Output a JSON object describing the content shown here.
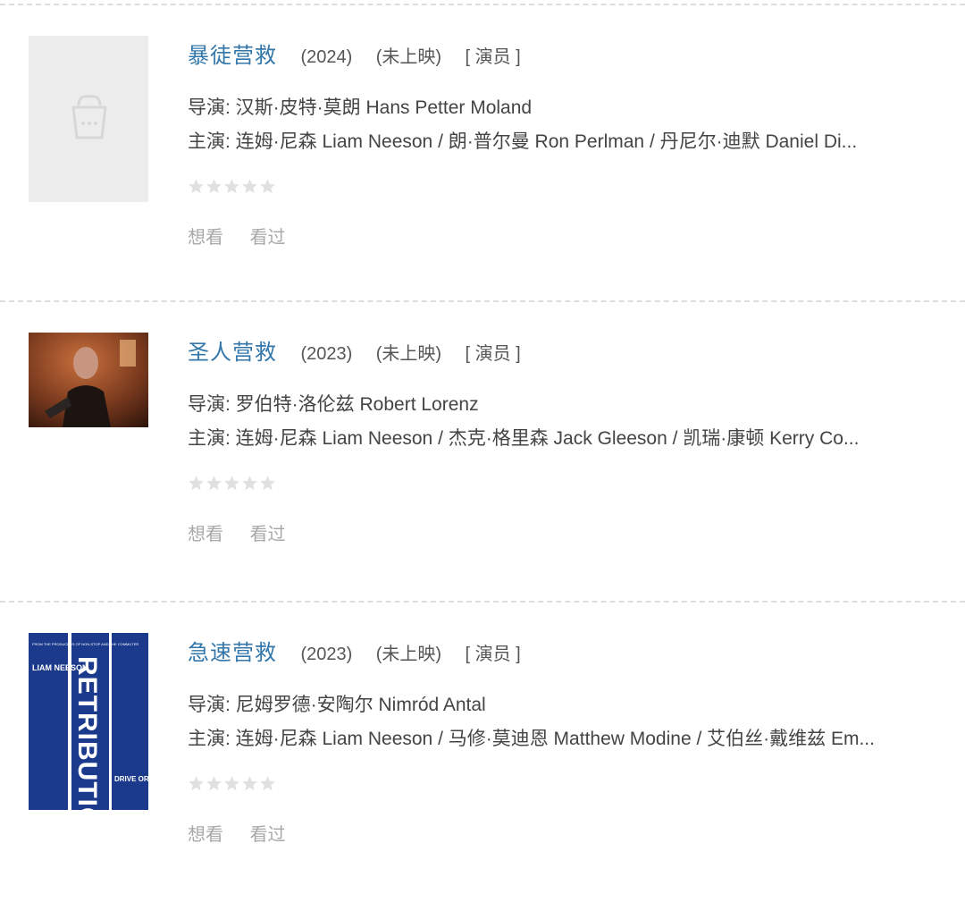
{
  "movies": [
    {
      "title": "暴徒营救",
      "year": "(2024)",
      "status": "(未上映)",
      "role": "[ 演员 ]",
      "director": "导演: 汉斯·皮特·莫朗 Hans Petter Moland",
      "cast": "主演: 连姆·尼森 Liam Neeson / 朗·普尔曼 Ron Perlman / 丹尼尔·迪默 Daniel Di...",
      "rating_stars": 0,
      "want_label": "想看",
      "seen_label": "看过",
      "poster_icon": "popcorn-placeholder-icon"
    },
    {
      "title": "圣人营救",
      "year": "(2023)",
      "status": "(未上映)",
      "role": "[ 演员 ]",
      "director": "导演: 罗伯特·洛伦兹 Robert Lorenz",
      "cast": "主演: 连姆·尼森 Liam Neeson / 杰克·格里森 Jack Gleeson / 凯瑞·康顿 Kerry Co...",
      "rating_stars": 0,
      "want_label": "想看",
      "seen_label": "看过"
    },
    {
      "title": "急速营救",
      "year": "(2023)",
      "status": "(未上映)",
      "role": "[ 演员 ]",
      "director": "导演: 尼姆罗德·安陶尔 Nimród Antal",
      "cast": "主演: 连姆·尼森 Liam Neeson / 马修·莫迪恩 Matthew Modine / 艾伯丝·戴维兹 Em...",
      "rating_stars": 0,
      "want_label": "想看",
      "seen_label": "看过",
      "poster_text": {
        "actor": "LIAM NEESON",
        "title": "RETRIBUTION",
        "tagline": "DRIVE OR DIE"
      }
    }
  ],
  "colors": {
    "title_link": "#3377aa",
    "star_empty": "#e0e0e0",
    "action_text": "#a8a8a8",
    "divider": "#dddddd"
  }
}
